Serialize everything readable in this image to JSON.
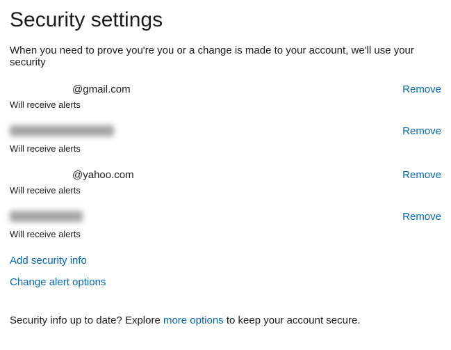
{
  "title": "Security settings",
  "intro": "When you need to prove you're you or a change is made to your account, we'll use your security",
  "alert_text": "Will receive alerts",
  "remove_label": "Remove",
  "items": [
    {
      "visible": "@gmail.com"
    },
    {
      "visible": ""
    },
    {
      "visible": "@yahoo.com"
    },
    {
      "visible": ""
    }
  ],
  "actions": {
    "add_security_info": "Add security info",
    "change_alert_options": "Change alert options"
  },
  "footer": {
    "prefix": "Security info up to date? Explore ",
    "link": "more options",
    "suffix": " to keep your account secure."
  }
}
